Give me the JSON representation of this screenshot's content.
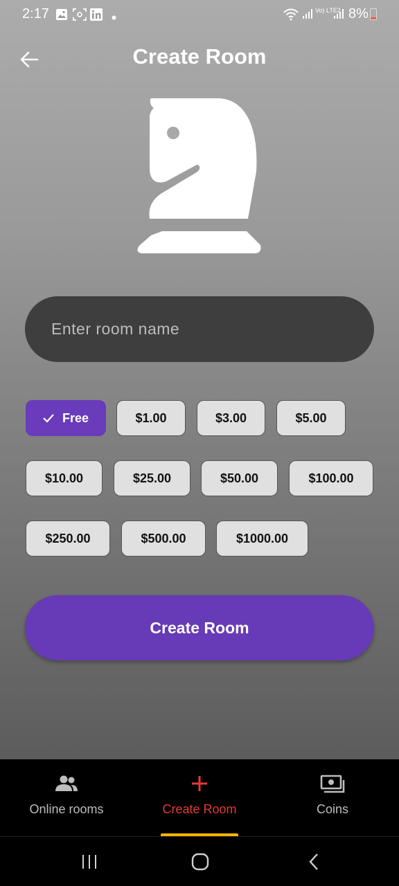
{
  "status_bar": {
    "time": "2:17",
    "battery": "8%",
    "volte": "Vo) LTE2"
  },
  "header": {
    "title": "Create Room",
    "back_icon": "arrow-left-icon"
  },
  "hero_icon": "chess-knight-icon",
  "room_name": {
    "value": "",
    "placeholder": "Enter room name"
  },
  "price_options": [
    {
      "label": "Free",
      "selected": true
    },
    {
      "label": "$1.00",
      "selected": false
    },
    {
      "label": "$3.00",
      "selected": false
    },
    {
      "label": "$5.00",
      "selected": false
    },
    {
      "label": "$10.00",
      "selected": false
    },
    {
      "label": "$25.00",
      "selected": false
    },
    {
      "label": "$50.00",
      "selected": false
    },
    {
      "label": "$100.00",
      "selected": false
    },
    {
      "label": "$250.00",
      "selected": false
    },
    {
      "label": "$500.00",
      "selected": false
    },
    {
      "label": "$1000.00",
      "selected": false
    }
  ],
  "create_button": {
    "label": "Create Room"
  },
  "bottom_nav": [
    {
      "label": "Online rooms",
      "icon": "people-icon",
      "active": false
    },
    {
      "label": "Create Room",
      "icon": "plus-icon",
      "active": true
    },
    {
      "label": "Coins",
      "icon": "money-icon",
      "active": false
    }
  ],
  "colors": {
    "accent": "#673ab7",
    "nav_active": "#e53935",
    "nav_indicator": "#f4b400"
  }
}
